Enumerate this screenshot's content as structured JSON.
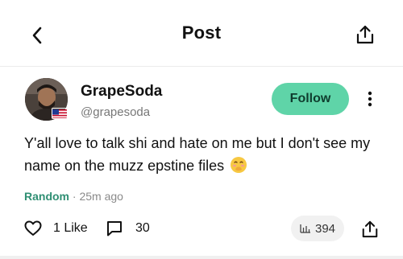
{
  "header": {
    "title": "Post",
    "back_icon": "chevron-left-icon",
    "share_icon": "share-icon"
  },
  "author": {
    "display_name": "GrapeSoda",
    "handle": "@grapesoda",
    "flag_icon": "us-flag-icon",
    "follow_label": "Follow",
    "follow_color": "#5fd4a8"
  },
  "post": {
    "text": "Y'all love to talk shi and hate on me but I don't see my name on the muzz epstine files",
    "emoji_icon": "hand-over-mouth-emoji",
    "tag": "Random",
    "separator": "·",
    "time": "25m ago"
  },
  "actions": {
    "likes_label": "1 Like",
    "comments_count": "30",
    "views_count": "394",
    "accent_color": "#2f8f73"
  }
}
